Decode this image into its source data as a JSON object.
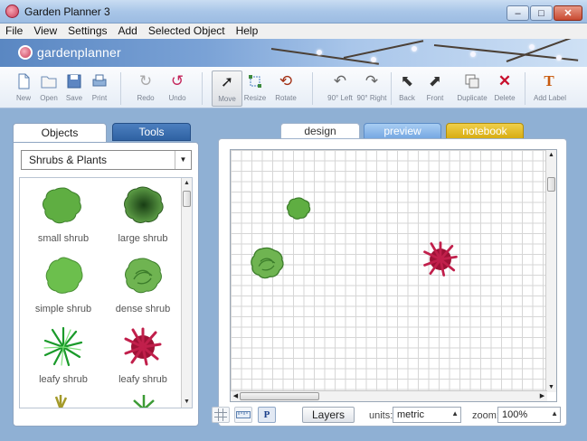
{
  "window": {
    "title": "Garden Planner 3"
  },
  "window_controls": {
    "minimize": "–",
    "maximize": "□",
    "close": "✕"
  },
  "menu": [
    "File",
    "View",
    "Settings",
    "Add",
    "Selected Object",
    "Help"
  ],
  "banner": {
    "logo_text": "gardenplanner"
  },
  "toolbar": {
    "new": "New",
    "open": "Open",
    "save": "Save",
    "print": "Print",
    "redo": "Redo",
    "undo": "Undo",
    "move": "Move",
    "resize": "Resize",
    "rotate": "Rotate",
    "rotate_left": "90° Left",
    "rotate_right": "90° Right",
    "back": "Back",
    "front": "Front",
    "duplicate": "Duplicate",
    "delete": "Delete",
    "add_label": "Add Label"
  },
  "left_tabs": {
    "objects": "Objects",
    "tools": "Tools"
  },
  "category": {
    "selected": "Shrubs & Plants"
  },
  "objects": [
    {
      "label": "small shrub",
      "icon": "small-shrub-icon"
    },
    {
      "label": "large shrub",
      "icon": "large-shrub-icon"
    },
    {
      "label": "simple shrub",
      "icon": "simple-shrub-icon"
    },
    {
      "label": "dense shrub",
      "icon": "dense-shrub-icon"
    },
    {
      "label": "leafy shrub",
      "icon": "leafy-shrub-green-icon"
    },
    {
      "label": "leafy shrub",
      "icon": "leafy-shrub-red-icon"
    }
  ],
  "view_tabs": {
    "design": "design",
    "preview": "preview",
    "notebook": "notebook"
  },
  "bottom": {
    "layers": "Layers",
    "units_label": "units:",
    "units_value": "metric",
    "zoom_label": "zoom:",
    "zoom_value": "100%",
    "p_button": "P"
  },
  "colors": {
    "titlebar": "#a9c6e8",
    "tools_tab": "#2f62a3",
    "preview_tab": "#76a8e2",
    "notebook_tab": "#d7ad12",
    "shrub_green": "#5aa83c",
    "shrub_red": "#b5163f"
  }
}
